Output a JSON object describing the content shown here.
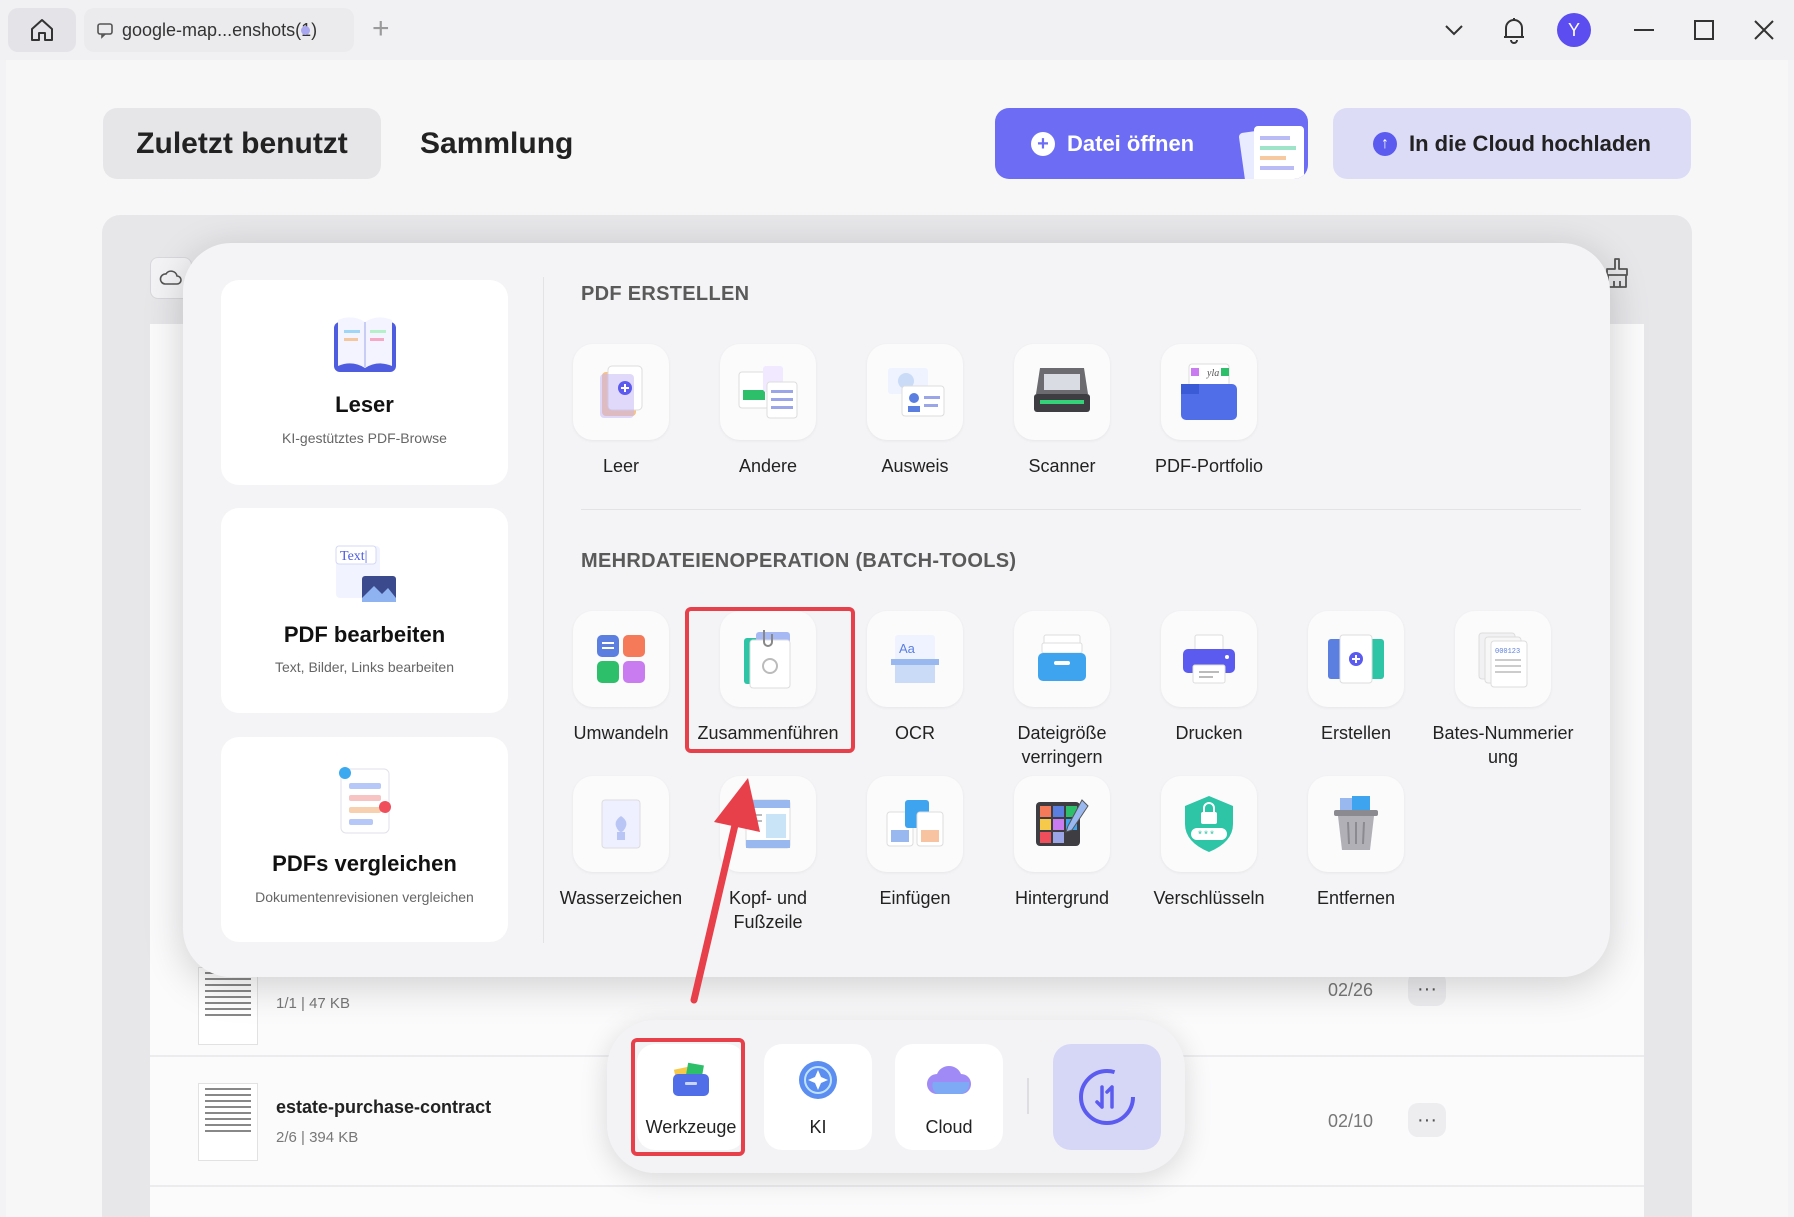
{
  "titlebar": {
    "tab_title": "google-map...enshots(1)",
    "new_tab": "+",
    "avatar_letter": "Y"
  },
  "header": {
    "nav_recent": "Zuletzt benutzt",
    "nav_collection": "Sammlung",
    "open_file": "Datei öffnen",
    "upload_cloud": "In die Cloud hochladen"
  },
  "files": [
    {
      "name": "",
      "meta": "1/1 | 47 KB",
      "date": "02/26"
    },
    {
      "name": "estate-purchase-contract",
      "meta": "2/6 | 394 KB",
      "date": "02/10"
    }
  ],
  "more_label": "···",
  "popup": {
    "cards": [
      {
        "title": "Leser",
        "desc": "KI-gestütztes PDF-Browse"
      },
      {
        "title": "PDF bearbeiten",
        "desc": "Text, Bilder, Links bearbeiten",
        "icon_text": "Text|"
      },
      {
        "title": "PDFs vergleichen",
        "desc": "Dokumentenrevisionen vergleichen"
      }
    ],
    "section_create": "PDF ERSTELLEN",
    "create_tools": [
      "Leer",
      "Andere",
      "Ausweis",
      "Scanner",
      "PDF-Portfolio"
    ],
    "section_batch": "MEHRDATEIENOPERATION (BATCH-TOOLS)",
    "batch_tools_row1": [
      "Umwandeln",
      "Zusammenführen",
      "OCR",
      "Dateigröße verringern",
      "Drucken",
      "Erstellen",
      "Bates-Nummerier ung"
    ],
    "batch_tools_row2": [
      "Wasserzeichen",
      "Kopf- und Fußzeile",
      "Einfügen",
      "Hintergrund",
      "Verschlüsseln",
      "Entfernen"
    ]
  },
  "dock": {
    "tools": "Werkzeuge",
    "ai": "KI",
    "cloud": "Cloud"
  },
  "colors": {
    "accent": "#6c6cf5",
    "highlight": "#e8404a"
  }
}
